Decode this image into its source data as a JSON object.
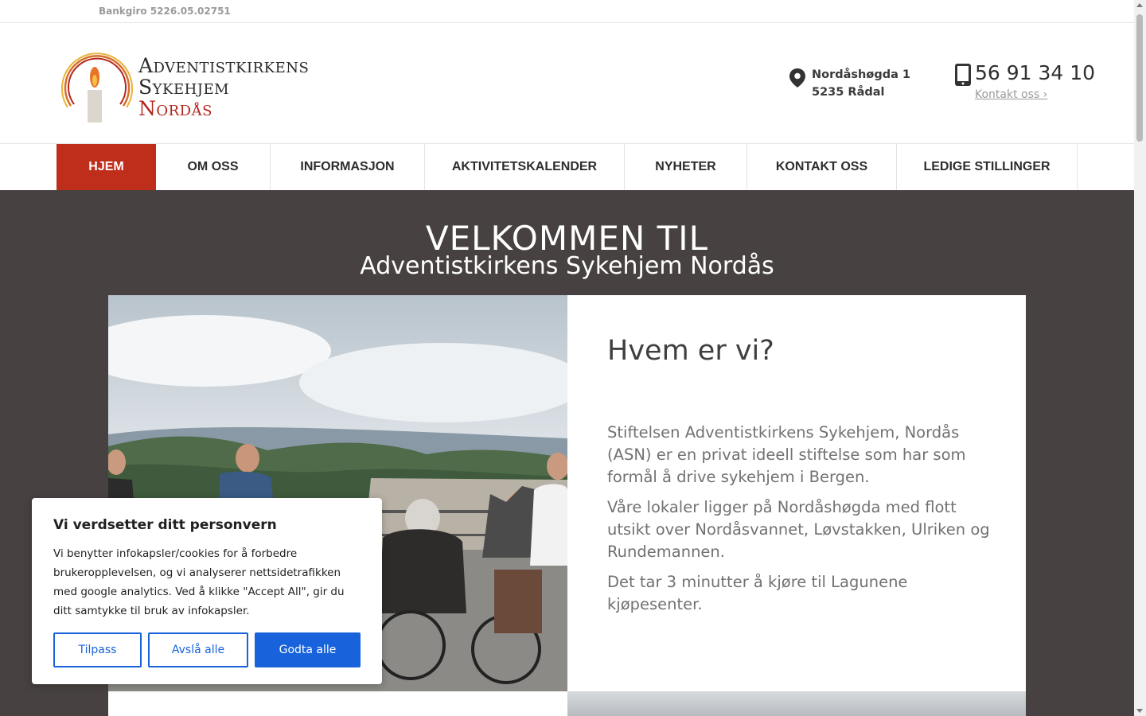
{
  "topbar": {
    "giro": "Bankgiro 5226.05.02751"
  },
  "logo": {
    "line1": "Adventistkirkens",
    "line2": "Sykehjem",
    "line3": "Nordås"
  },
  "address": {
    "line1": "Nordåshøgda 1",
    "line2": "5235 Rådal"
  },
  "phone": {
    "number": "56 91 34 10",
    "contact_link": "Kontakt oss ›"
  },
  "nav": {
    "items": [
      {
        "label": "HJEM"
      },
      {
        "label": "OM OSS"
      },
      {
        "label": "INFORMASJON"
      },
      {
        "label": "AKTIVITETSKALENDER"
      },
      {
        "label": "NYHETER"
      },
      {
        "label": "KONTAKT OSS"
      },
      {
        "label": "LEDIGE STILLINGER"
      }
    ]
  },
  "hero": {
    "title": "VELKOMMEN TIL",
    "subtitle": "Adventistkirkens Sykehjem Nordås"
  },
  "about": {
    "title": "Hvem er vi?",
    "p1": "Stiftelsen Adventistkirkens Sykehjem, Nordås (ASN) er en privat ideell stiftelse som har som formål å drive sykehjem i Bergen.",
    "p2": "Våre lokaler ligger på Nordåshøgda med flott utsikt over Nordåsvannet, Løvstakken, Ulriken og Rundemannen.",
    "p3": "Det tar 3 minutter å kjøre til Lagunene kjøpesenter."
  },
  "cookie": {
    "title": "Vi verdsetter ditt personvern",
    "body": "Vi benytter infokapsler/cookies for å forbedre brukeropplevelsen, og vi analyserer nettsidetrafikken med google analytics. Ved å klikke \"Accept All\", gir du ditt samtykke til bruk av infokapsler.",
    "customize": "Tilpass",
    "reject": "Avslå alle",
    "accept": "Godta alle"
  },
  "colors": {
    "accent": "#bf2e1b",
    "hero_bg": "#474241",
    "cookie_blue": "#1863dc"
  }
}
